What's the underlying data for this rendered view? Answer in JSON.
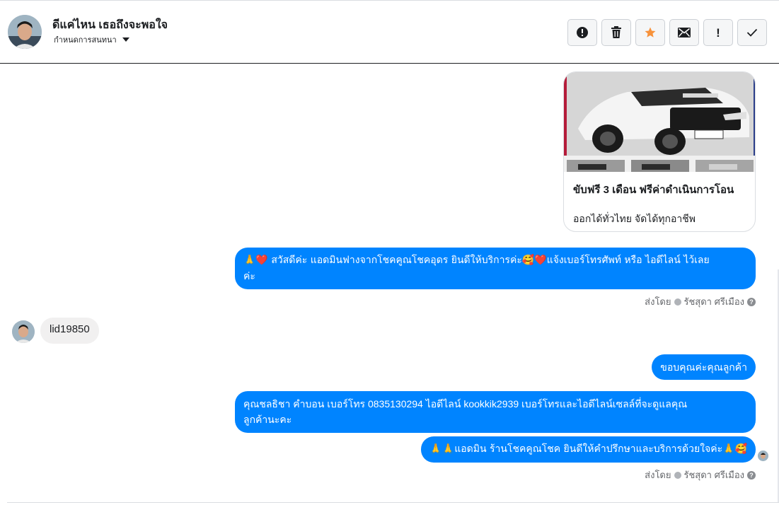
{
  "header": {
    "name": "ดีแค่ไหน เธอถึงจะพอใจ",
    "subtitle": "กำหนดการสนทนา",
    "actions": [
      {
        "name": "report-button",
        "icon": "alert-circle-icon"
      },
      {
        "name": "delete-button",
        "icon": "trash-icon"
      },
      {
        "name": "star-button",
        "icon": "star-icon"
      },
      {
        "name": "mark-unread-button",
        "icon": "envelope-icon"
      },
      {
        "name": "mark-important-button",
        "icon": "exclamation-icon",
        "text": "!"
      },
      {
        "name": "mark-done-button",
        "icon": "check-icon"
      }
    ],
    "star_color": "#f7923b"
  },
  "card": {
    "title": "ขับฟรี 3 เดือน ฟรีค่าดำเนินการโอน",
    "subtitle": "ออกได้ทั่วไทย จัดได้ทุกอาชีพ"
  },
  "messages": {
    "m1": "🙏❤️ สวัสดีค่ะ แอดมินฟางจากโชคคูณโชคอุดร ยินดีให้บริการค่ะ🥰❤️แจ้งเบอร์โทรศัพท์ หรือ ไอดีไลน์  ไว้เลย",
    "m1_line2": "ค่ะ",
    "m2_incoming": "lid19850",
    "m3": "ขอบคุณค่ะคุณลูกค้า",
    "m4": "คุณชลธิชา คำบอน เบอร์โทร 0835130294  ไอดีไลน์ kookkik2939  เบอร์โทรและไอดีไลน์เซลล์ที่จะดูแลคุณ",
    "m4_line2": "ลูกค้านะคะ",
    "m5": "🙏🙏แอดมิน ร้านโชคคูณโชค ยินดีให้คำปรึกษาและบริการด้วยใจค่ะ🙏🥰"
  },
  "sent_by": {
    "label": "ส่งโดย",
    "agent": "รัชสุดา ศรีเมือง"
  },
  "colors": {
    "outgoing_bubble": "#0084ff",
    "incoming_bubble": "#f1f0f0"
  }
}
